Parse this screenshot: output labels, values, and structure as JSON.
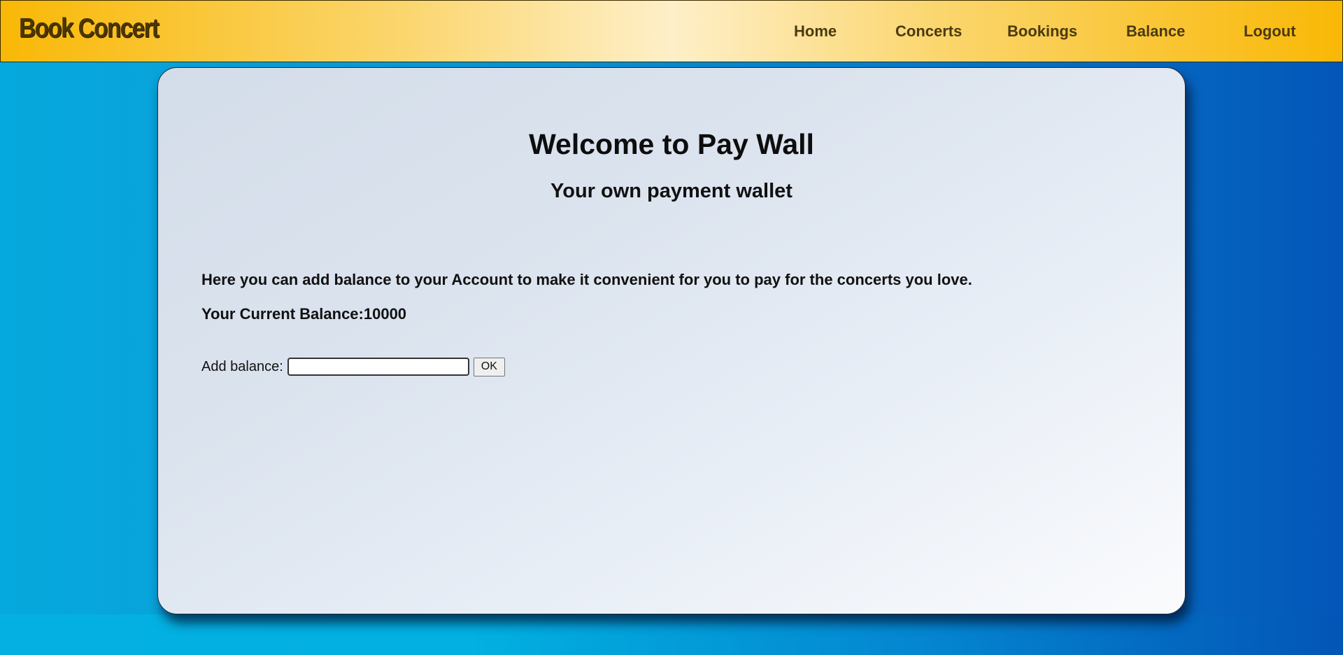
{
  "navbar": {
    "brand": "Book Concert",
    "links": {
      "home": "Home",
      "concerts": "Concerts",
      "bookings": "Bookings",
      "balance": "Balance",
      "logout": "Logout"
    }
  },
  "main": {
    "title": "Welcome to Pay Wall",
    "subtitle": "Your own payment wallet",
    "description": "Here you can add balance to your Account to make it convenient for you to pay for the concerts you love.",
    "current_balance": "Your Current Balance:10000",
    "add_balance": {
      "label": "Add balance:",
      "value": "",
      "placeholder": "",
      "button_label": "OK"
    }
  },
  "colors": {
    "navbar_gold": "#f9b806",
    "navbar_center": "#feefc8",
    "page_blue_left": "#06a9dd",
    "page_blue_right": "#0456b8",
    "brand_text": "#4b3500",
    "nav_text": "#4a3a10"
  }
}
